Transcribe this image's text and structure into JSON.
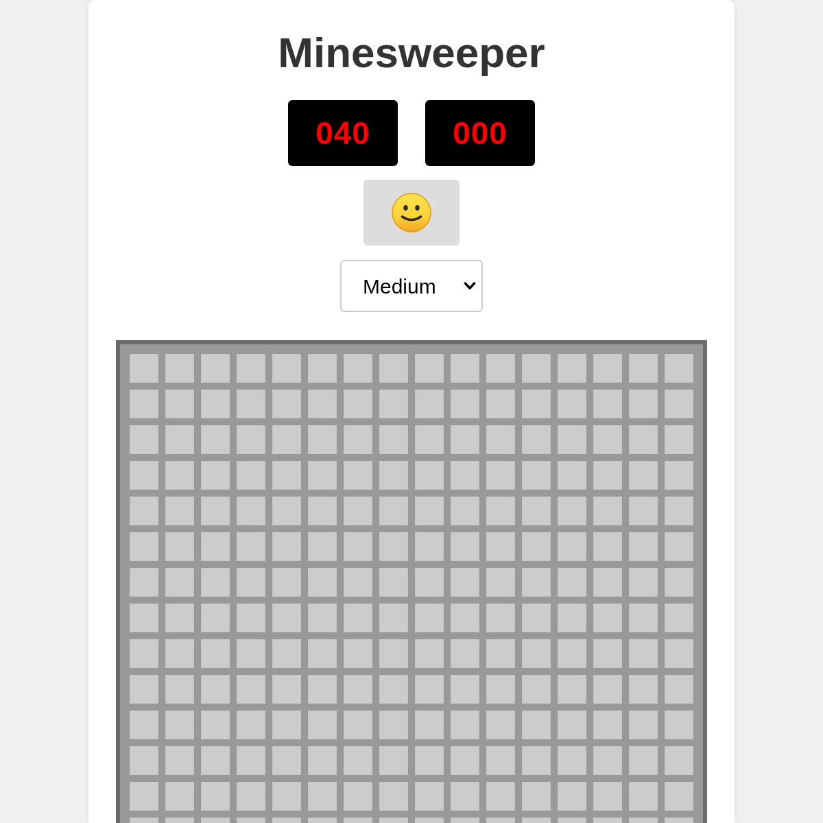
{
  "title": "Minesweeper",
  "counters": [
    {
      "text": "040"
    },
    {
      "text": "000"
    }
  ],
  "difficulty": {
    "value": "Medium"
  },
  "board": {
    "rows": [
      [
        {
          "revealed": false
        },
        {
          "revealed": false
        },
        {
          "revealed": false
        },
        {
          "revealed": false
        },
        {
          "revealed": false
        },
        {
          "revealed": false
        },
        {
          "revealed": false
        },
        {
          "revealed": false
        },
        {
          "revealed": false
        },
        {
          "revealed": false
        },
        {
          "revealed": false
        },
        {
          "revealed": false
        },
        {
          "revealed": false
        },
        {
          "revealed": false
        },
        {
          "revealed": false
        },
        {
          "revealed": false
        }
      ],
      [
        {
          "revealed": false
        },
        {
          "revealed": false
        },
        {
          "revealed": false
        },
        {
          "revealed": false
        },
        {
          "revealed": false
        },
        {
          "revealed": false
        },
        {
          "revealed": false
        },
        {
          "revealed": false
        },
        {
          "revealed": false
        },
        {
          "revealed": false
        },
        {
          "revealed": false
        },
        {
          "revealed": false
        },
        {
          "revealed": false
        },
        {
          "revealed": false
        },
        {
          "revealed": false
        },
        {
          "revealed": false
        }
      ],
      [
        {
          "revealed": false
        },
        {
          "revealed": false
        },
        {
          "revealed": false
        },
        {
          "revealed": false
        },
        {
          "revealed": false
        },
        {
          "revealed": false
        },
        {
          "revealed": false
        },
        {
          "revealed": false
        },
        {
          "revealed": false
        },
        {
          "revealed": false
        },
        {
          "revealed": false
        },
        {
          "revealed": false
        },
        {
          "revealed": false
        },
        {
          "revealed": false
        },
        {
          "revealed": false
        },
        {
          "revealed": false
        }
      ],
      [
        {
          "revealed": false
        },
        {
          "revealed": false
        },
        {
          "revealed": false
        },
        {
          "revealed": false
        },
        {
          "revealed": false
        },
        {
          "revealed": false
        },
        {
          "revealed": false
        },
        {
          "revealed": false
        },
        {
          "revealed": false
        },
        {
          "revealed": false
        },
        {
          "revealed": false
        },
        {
          "revealed": false
        },
        {
          "revealed": false
        },
        {
          "revealed": false
        },
        {
          "revealed": false
        },
        {
          "revealed": false
        }
      ],
      [
        {
          "revealed": false
        },
        {
          "revealed": false
        },
        {
          "revealed": false
        },
        {
          "revealed": false
        },
        {
          "revealed": false
        },
        {
          "revealed": false
        },
        {
          "revealed": false
        },
        {
          "revealed": false
        },
        {
          "revealed": false
        },
        {
          "revealed": false
        },
        {
          "revealed": false
        },
        {
          "revealed": false
        },
        {
          "revealed": false
        },
        {
          "revealed": false
        },
        {
          "revealed": false
        },
        {
          "revealed": false
        }
      ],
      [
        {
          "revealed": false
        },
        {
          "revealed": false
        },
        {
          "revealed": false
        },
        {
          "revealed": false
        },
        {
          "revealed": false
        },
        {
          "revealed": false
        },
        {
          "revealed": false
        },
        {
          "revealed": false
        },
        {
          "revealed": false
        },
        {
          "revealed": false
        },
        {
          "revealed": false
        },
        {
          "revealed": false
        },
        {
          "revealed": false
        },
        {
          "revealed": false
        },
        {
          "revealed": false
        },
        {
          "revealed": false
        }
      ],
      [
        {
          "revealed": false
        },
        {
          "revealed": false
        },
        {
          "revealed": false
        },
        {
          "revealed": false
        },
        {
          "revealed": false
        },
        {
          "revealed": false
        },
        {
          "revealed": false
        },
        {
          "revealed": false
        },
        {
          "revealed": false
        },
        {
          "revealed": false
        },
        {
          "revealed": false
        },
        {
          "revealed": false
        },
        {
          "revealed": false
        },
        {
          "revealed": false
        },
        {
          "revealed": false
        },
        {
          "revealed": false
        }
      ],
      [
        {
          "revealed": false
        },
        {
          "revealed": false
        },
        {
          "revealed": false
        },
        {
          "revealed": false
        },
        {
          "revealed": false
        },
        {
          "revealed": false
        },
        {
          "revealed": false
        },
        {
          "revealed": false
        },
        {
          "revealed": false
        },
        {
          "revealed": false
        },
        {
          "revealed": false
        },
        {
          "revealed": false
        },
        {
          "revealed": false
        },
        {
          "revealed": false
        },
        {
          "revealed": false
        },
        {
          "revealed": false
        }
      ],
      [
        {
          "revealed": false
        },
        {
          "revealed": false
        },
        {
          "revealed": false
        },
        {
          "revealed": false
        },
        {
          "revealed": false
        },
        {
          "revealed": false
        },
        {
          "revealed": false
        },
        {
          "revealed": false
        },
        {
          "revealed": false
        },
        {
          "revealed": false
        },
        {
          "revealed": false
        },
        {
          "revealed": false
        },
        {
          "revealed": false
        },
        {
          "revealed": false
        },
        {
          "revealed": false
        },
        {
          "revealed": false
        }
      ],
      [
        {
          "revealed": false
        },
        {
          "revealed": false
        },
        {
          "revealed": false
        },
        {
          "revealed": false
        },
        {
          "revealed": false
        },
        {
          "revealed": false
        },
        {
          "revealed": false
        },
        {
          "revealed": false
        },
        {
          "revealed": false
        },
        {
          "revealed": false
        },
        {
          "revealed": false
        },
        {
          "revealed": false
        },
        {
          "revealed": false
        },
        {
          "revealed": false
        },
        {
          "revealed": false
        },
        {
          "revealed": false
        }
      ],
      [
        {
          "revealed": false
        },
        {
          "revealed": false
        },
        {
          "revealed": false
        },
        {
          "revealed": false
        },
        {
          "revealed": false
        },
        {
          "revealed": false
        },
        {
          "revealed": false
        },
        {
          "revealed": false
        },
        {
          "revealed": false
        },
        {
          "revealed": false
        },
        {
          "revealed": false
        },
        {
          "revealed": false
        },
        {
          "revealed": false
        },
        {
          "revealed": false
        },
        {
          "revealed": false
        },
        {
          "revealed": false
        }
      ],
      [
        {
          "revealed": false
        },
        {
          "revealed": false
        },
        {
          "revealed": false
        },
        {
          "revealed": false
        },
        {
          "revealed": false
        },
        {
          "revealed": false
        },
        {
          "revealed": false
        },
        {
          "revealed": false
        },
        {
          "revealed": false
        },
        {
          "revealed": false
        },
        {
          "revealed": false
        },
        {
          "revealed": false
        },
        {
          "revealed": false
        },
        {
          "revealed": false
        },
        {
          "revealed": false
        },
        {
          "revealed": false
        }
      ],
      [
        {
          "revealed": false
        },
        {
          "revealed": false
        },
        {
          "revealed": false
        },
        {
          "revealed": false
        },
        {
          "revealed": false
        },
        {
          "revealed": false
        },
        {
          "revealed": false
        },
        {
          "revealed": false
        },
        {
          "revealed": false
        },
        {
          "revealed": false
        },
        {
          "revealed": false
        },
        {
          "revealed": false
        },
        {
          "revealed": false
        },
        {
          "revealed": false
        },
        {
          "revealed": false
        },
        {
          "revealed": false
        }
      ],
      [
        {
          "revealed": false
        },
        {
          "revealed": false
        },
        {
          "revealed": false
        },
        {
          "revealed": false
        },
        {
          "revealed": false
        },
        {
          "revealed": false
        },
        {
          "revealed": false
        },
        {
          "revealed": false
        },
        {
          "revealed": false
        },
        {
          "revealed": false
        },
        {
          "revealed": false
        },
        {
          "revealed": false
        },
        {
          "revealed": false
        },
        {
          "revealed": false
        },
        {
          "revealed": false
        },
        {
          "revealed": false
        }
      ]
    ]
  }
}
